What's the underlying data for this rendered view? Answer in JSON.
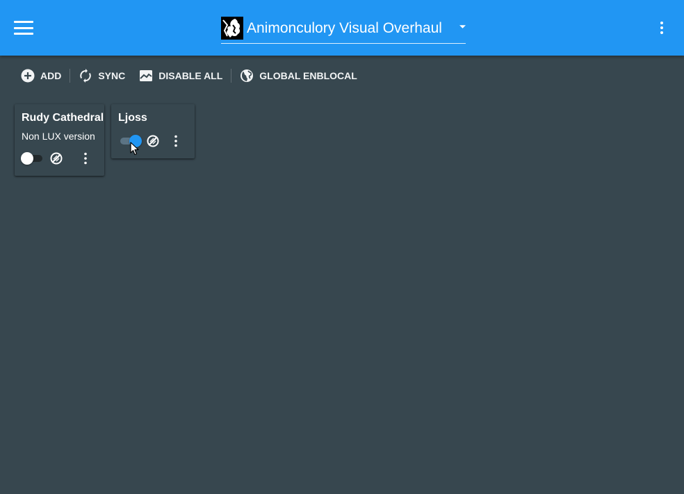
{
  "appbar": {
    "title": "Animonculory Visual Overhaul",
    "menu_icon": "hamburger-menu-icon",
    "more_icon": "more-vert-icon",
    "accent_color": "#2196f3"
  },
  "toolbar": {
    "add_label": "ADD",
    "sync_label": "SYNC",
    "disable_all_label": "DISABLE ALL",
    "global_enblocal_label": "GLOBAL ENBLOCAL"
  },
  "cards": [
    {
      "title": "Rudy Cathedral",
      "subtitle": "Non LUX version",
      "enabled": false
    },
    {
      "title": "Ljoss",
      "subtitle": "",
      "enabled": true
    }
  ],
  "colors": {
    "background": "#37474f",
    "toggle_on": "#2196f3",
    "toggle_off_thumb": "#ffffff"
  }
}
